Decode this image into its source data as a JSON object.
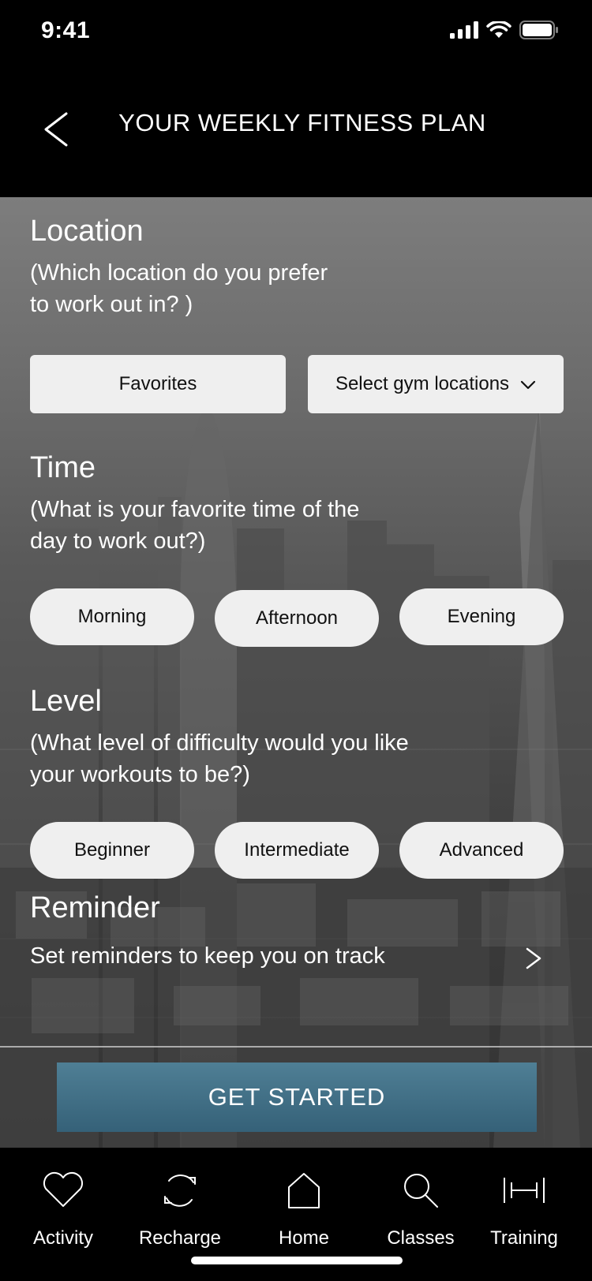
{
  "status_bar": {
    "time": "9:41"
  },
  "header": {
    "title": "YOUR WEEKLY FITNESS PLAN"
  },
  "location": {
    "title": "Location",
    "subtitle_line1": "(Which location do you prefer",
    "subtitle_line2": "to work out in? )",
    "favorites_label": "Favorites",
    "select_label": "Select gym locations"
  },
  "time": {
    "title": "Time",
    "subtitle_line1": "(What is your favorite time of the",
    "subtitle_line2": "day to work out?)",
    "options": [
      "Morning",
      "Afternoon",
      "Evening"
    ]
  },
  "level": {
    "title": "Level",
    "subtitle_line1": "(What level of difficulty would you like",
    "subtitle_line2": "your workouts to be?)",
    "options": [
      "Beginner",
      "Intermediate",
      "Advanced"
    ]
  },
  "reminder": {
    "title": "Reminder",
    "subtitle": "Set reminders to keep you on track"
  },
  "cta": {
    "label": "GET STARTED"
  },
  "tabs": [
    {
      "label": "Activity",
      "icon": "heart-icon"
    },
    {
      "label": "Recharge",
      "icon": "recharge-icon"
    },
    {
      "label": "Home",
      "icon": "home-icon"
    },
    {
      "label": "Classes",
      "icon": "search-icon"
    },
    {
      "label": "Training",
      "icon": "dumbbell-icon"
    }
  ],
  "colors": {
    "cta": "#3f6f86",
    "button_bg": "#efefef",
    "background": "#000000"
  }
}
